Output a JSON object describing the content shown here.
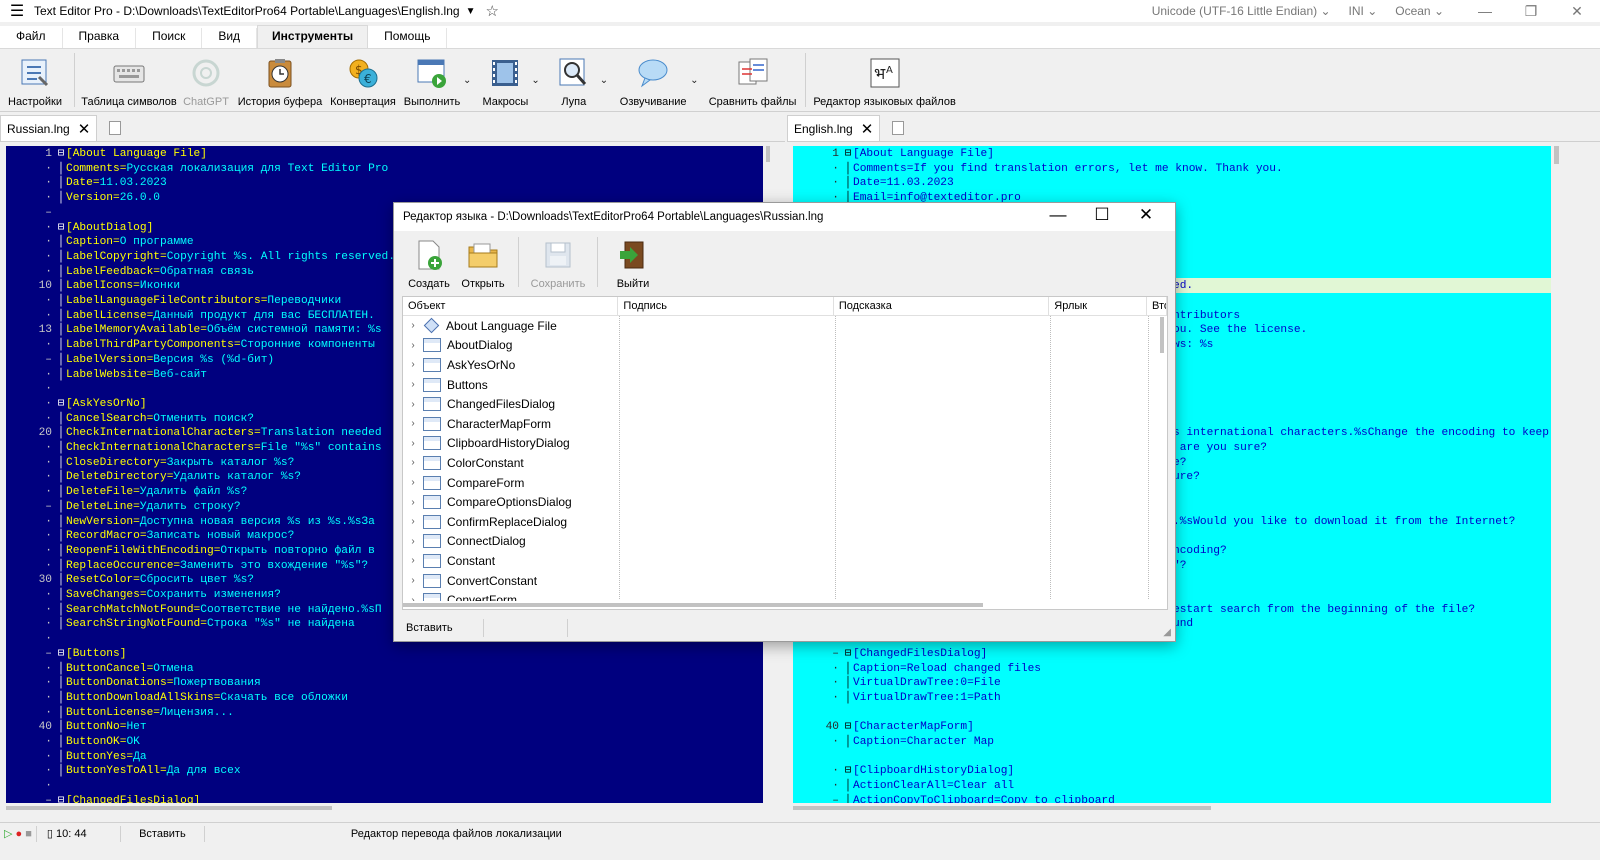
{
  "window": {
    "title": "Text Editor Pro  -  D:\\Downloads\\TextEditorPro64 Portable\\Languages\\English.lng",
    "encoding": "Unicode (UTF-16 Little Endian)",
    "highlighter": "INI",
    "skin": "Ocean"
  },
  "menu": [
    "Файл",
    "Правка",
    "Поиск",
    "Вид",
    "Инструменты",
    "Помощь"
  ],
  "ribbon": {
    "settings": "Настройки",
    "char_table": "Таблица символов",
    "chatgpt": "ChatGPT",
    "clipboard_history": "История буфера",
    "convert": "Конвертация",
    "run": "Выполнить",
    "macros": "Макросы",
    "magnifier": "Лупа",
    "speech": "Озвучивание",
    "compare": "Сравнить файлы",
    "lang_editor": "Редактор языковых файлов"
  },
  "left_tab": "Russian.lng",
  "right_tab": "English.lng",
  "left_lines": [
    {
      "n": "1",
      "f": "⊟",
      "k": "[About Language File]",
      "v": ""
    },
    {
      "n": "·",
      "f": "",
      "k": "Comments=",
      "v": "Русская локализация для Text Editor Pro"
    },
    {
      "n": "·",
      "f": "",
      "k": "Date=",
      "v": "11.03.2023"
    },
    {
      "n": "·",
      "f": "",
      "k": "Version=",
      "v": "26.0.0"
    },
    {
      "n": "–",
      "f": "",
      "k": "",
      "v": ""
    },
    {
      "n": "·",
      "f": "⊟",
      "k": "[AboutDialog]",
      "v": ""
    },
    {
      "n": "·",
      "f": "",
      "k": "Caption=",
      "v": "О программе"
    },
    {
      "n": "·",
      "f": "",
      "k": "LabelCopyright=",
      "v": "Copyright %s. All rights reserved."
    },
    {
      "n": "·",
      "f": "",
      "k": "LabelFeedback=",
      "v": "Обратная связь"
    },
    {
      "n": "10",
      "f": "",
      "k": "LabelIcons=",
      "v": "Иконки"
    },
    {
      "n": "·",
      "f": "",
      "k": "LabelLanguageFileContributors=",
      "v": "Переводчики"
    },
    {
      "n": "·",
      "f": "",
      "k": "LabelLicense=",
      "v": "Данный продукт для вас БЕСПЛАТЕН."
    },
    {
      "n": "13",
      "f": "",
      "k": "LabelMemoryAvailable=",
      "v": "Объём системной памяти: %s"
    },
    {
      "n": "·",
      "f": "",
      "k": "LabelThirdPartyComponents=",
      "v": "Сторонние компоненты"
    },
    {
      "n": "–",
      "f": "",
      "k": "LabelVersion=",
      "v": "Версия %s (%d-бит)"
    },
    {
      "n": "·",
      "f": "",
      "k": "LabelWebsite=",
      "v": "Веб-сайт"
    },
    {
      "n": "·",
      "f": "",
      "k": "",
      "v": ""
    },
    {
      "n": "·",
      "f": "⊟",
      "k": "[AskYesOrNo]",
      "v": ""
    },
    {
      "n": "·",
      "f": "",
      "k": "CancelSearch=",
      "v": "Отменить поиск?"
    },
    {
      "n": "20",
      "f": "",
      "k": "CheckInternationalCharacters=",
      "v": "Translation needed"
    },
    {
      "n": "·",
      "f": "",
      "k": "CheckInternationalCharacters=",
      "v": "File \"%s\" contains"
    },
    {
      "n": "·",
      "f": "",
      "k": "CloseDirectory=",
      "v": "Закрыть каталог %s?"
    },
    {
      "n": "·",
      "f": "",
      "k": "DeleteDirectory=",
      "v": "Удалить каталог %s?"
    },
    {
      "n": "·",
      "f": "",
      "k": "DeleteFile=",
      "v": "Удалить файл %s?"
    },
    {
      "n": "–",
      "f": "",
      "k": "DeleteLine=",
      "v": "Удалить строку?"
    },
    {
      "n": "·",
      "f": "",
      "k": "NewVersion=",
      "v": "Доступна новая версия %s из %s.%sЗа"
    },
    {
      "n": "·",
      "f": "",
      "k": "RecordMacro=",
      "v": "Записать новый макрос?"
    },
    {
      "n": "·",
      "f": "",
      "k": "ReopenFileWithEncoding=",
      "v": "Открыть повторно файл в"
    },
    {
      "n": "·",
      "f": "",
      "k": "ReplaceOccurence=",
      "v": "Заменить это вхождение \"%s\"?"
    },
    {
      "n": "30",
      "f": "",
      "k": "ResetColor=",
      "v": "Сбросить цвет %s?"
    },
    {
      "n": "·",
      "f": "",
      "k": "SaveChanges=",
      "v": "Сохранить изменения?"
    },
    {
      "n": "·",
      "f": "",
      "k": "SearchMatchNotFound=",
      "v": "Соответствие не найдено.%sП"
    },
    {
      "n": "·",
      "f": "",
      "k": "SearchStringNotFound=",
      "v": "Строка \"%s\" не найдена"
    },
    {
      "n": "·",
      "f": "",
      "k": "",
      "v": ""
    },
    {
      "n": "–",
      "f": "⊟",
      "k": "[Buttons]",
      "v": ""
    },
    {
      "n": "·",
      "f": "",
      "k": "ButtonCancel=",
      "v": "Отмена"
    },
    {
      "n": "·",
      "f": "",
      "k": "ButtonDonations=",
      "v": "Пожертвования"
    },
    {
      "n": "·",
      "f": "",
      "k": "ButtonDownloadAllSkins=",
      "v": "Скачать все обложки"
    },
    {
      "n": "·",
      "f": "",
      "k": "ButtonLicense=",
      "v": "Лицензия..."
    },
    {
      "n": "40",
      "f": "",
      "k": "ButtonNo=",
      "v": "Нет"
    },
    {
      "n": "·",
      "f": "",
      "k": "ButtonOK=",
      "v": "OK"
    },
    {
      "n": "·",
      "f": "",
      "k": "ButtonYes=",
      "v": "Да"
    },
    {
      "n": "·",
      "f": "",
      "k": "ButtonYesToAll=",
      "v": "Да для всех"
    },
    {
      "n": "·",
      "f": "",
      "k": "",
      "v": ""
    },
    {
      "n": "–",
      "f": "⊟",
      "k": "[ChangedFilesDialog]",
      "v": ""
    }
  ],
  "right_lines": [
    {
      "row": 0,
      "n": "1",
      "f": "⊟",
      "k": "[About Language File]",
      "v": ""
    },
    {
      "row": 1,
      "n": "·",
      "f": "",
      "k": "Comments=",
      "v": "If you find translation errors, let me know. Thank you."
    },
    {
      "row": 2,
      "n": "·",
      "f": "",
      "k": "Date=",
      "v": "11.03.2023"
    },
    {
      "row": 3,
      "n": "·",
      "f": "",
      "k": "Email=",
      "v": "info@texteditor.pro"
    },
    {
      "row": 9,
      "n": "",
      "f": "",
      "k": "",
      "v": "ed."
    },
    {
      "row": 11,
      "n": "",
      "f": "",
      "k": "",
      "v": "ntributors"
    },
    {
      "row": 12,
      "n": "",
      "f": "",
      "k": "",
      "v": "ou. See the license."
    },
    {
      "row": 13,
      "n": "",
      "f": "",
      "k": "",
      "v": "ws: %s"
    },
    {
      "row": 19,
      "n": "",
      "f": "",
      "k": "",
      "v": "s international characters.%sChange the encoding to keep"
    },
    {
      "row": 20,
      "n": "",
      "f": "",
      "k": "",
      "v": " are you sure?"
    },
    {
      "row": 21,
      "n": "",
      "f": "",
      "k": "",
      "v": "e?"
    },
    {
      "row": 22,
      "n": "",
      "f": "",
      "k": "",
      "v": "ure?"
    },
    {
      "row": 25,
      "n": "",
      "f": "",
      "k": "",
      "v": ".%sWould you like to download it from the Internet?"
    },
    {
      "row": 27,
      "n": "",
      "f": "",
      "k": "",
      "v": "ncoding?"
    },
    {
      "row": 28,
      "n": "",
      "f": "",
      "k": "",
      "v": "\"?"
    },
    {
      "row": 31,
      "n": "",
      "f": "",
      "k": "",
      "v": "estart search from the beginning of the file?"
    },
    {
      "row": 32,
      "n": "",
      "f": "",
      "k": "",
      "v": "und"
    },
    {
      "row": 34,
      "n": "–",
      "f": "⊟",
      "k": "[ChangedFilesDialog]",
      "v": ""
    },
    {
      "row": 35,
      "n": "·",
      "f": "",
      "k": "Caption=",
      "v": "Reload changed files"
    },
    {
      "row": 36,
      "n": "·",
      "f": "",
      "k": "VirtualDrawTree:0=",
      "v": "File"
    },
    {
      "row": 37,
      "n": "·",
      "f": "",
      "k": "VirtualDrawTree:1=",
      "v": "Path"
    },
    {
      "row": 39,
      "n": "40",
      "f": "⊟",
      "k": "[CharacterMapForm]",
      "v": ""
    },
    {
      "row": 40,
      "n": "·",
      "f": "",
      "k": "Caption=",
      "v": "Character Map"
    },
    {
      "row": 42,
      "n": "·",
      "f": "⊟",
      "k": "[ClipboardHistoryDialog]",
      "v": ""
    },
    {
      "row": 43,
      "n": "·",
      "f": "",
      "k": "ActionClearAll=",
      "v": "Clear all"
    },
    {
      "row": 44,
      "n": "–",
      "f": "",
      "k": "ActionCopyToClipboard=",
      "v": "Copy to clipboard"
    }
  ],
  "dialog": {
    "title": "Редактор языка - D:\\Downloads\\TextEditorPro64 Portable\\Languages\\Russian.lng",
    "tools": {
      "create": "Создать",
      "open": "Открыть",
      "save": "Сохранить",
      "exit": "Выйти"
    },
    "columns": [
      "Объект",
      "Подпись",
      "Подсказка",
      "Ярлык",
      "Вто"
    ],
    "items": [
      "About Language File",
      "AboutDialog",
      "AskYesOrNo",
      "Buttons",
      "ChangedFilesDialog",
      "CharacterMapForm",
      "ClipboardHistoryDialog",
      "ColorConstant",
      "CompareForm",
      "CompareOptionsDialog",
      "ConfirmReplaceDialog",
      "ConnectDialog",
      "Constant",
      "ConvertConstant",
      "ConvertForm"
    ],
    "status": "Вставить"
  },
  "status": {
    "position": "10: 44",
    "mode": "Вставить",
    "message": "Редактор перевода файлов локализации"
  },
  "colors": {
    "left_bg": "#00007f",
    "right_bg": "#00ffff",
    "highlight": "#e1f7d5"
  }
}
